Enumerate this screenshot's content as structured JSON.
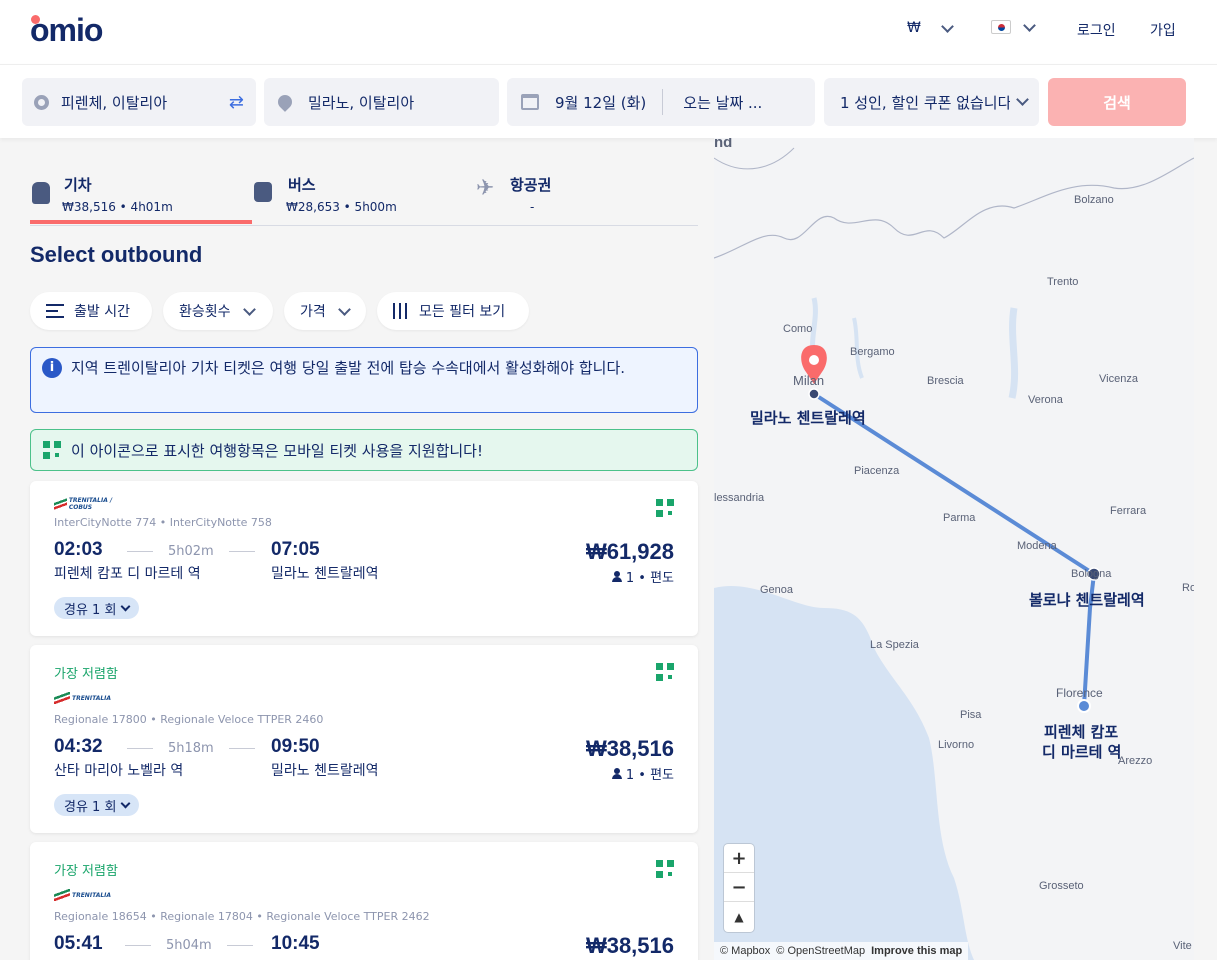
{
  "header": {
    "logo": "omio",
    "currency": "₩",
    "language_flag": "korea-flag",
    "login": "로그인",
    "signup": "가입"
  },
  "search": {
    "from": "피렌체, 이탈리아",
    "to": "밀라노, 이탈리아",
    "depart_date": "9월 12일 (화)",
    "return_date_placeholder": "오는 날짜 ...",
    "passengers": "1 성인, 할인 쿠폰 없습니다",
    "search_button": "검색"
  },
  "tabs": [
    {
      "label": "기차",
      "sub": "₩38,516 • 4h01m",
      "icon": "train-icon",
      "active": true
    },
    {
      "label": "버스",
      "sub": "₩28,653 • 5h00m",
      "icon": "bus-icon",
      "active": false
    },
    {
      "label": "항공권",
      "sub": "-",
      "icon": "plane-icon",
      "active": false
    }
  ],
  "section_title": "Select outbound",
  "filters": {
    "departure_time": "출발 시간",
    "transfers": "환승횟수",
    "price": "가격",
    "all_filters": "모든 필터 보기"
  },
  "info_notice": "지역 트렌이탈리아 기차 티켓은 여행 당일 출발 전에 탑승 수속대에서 활성화해야 합니다.",
  "mobile_notice": "이 아이콘으로 표시한 여행항목은 모바일 티켓 사용을 지원합니다!",
  "results": [
    {
      "badge": "",
      "operator": "TRENITALIA / COBUS",
      "trains": "InterCityNotte 774 • InterCityNotte 758",
      "dep_time": "02:03",
      "duration": "5h02m",
      "arr_time": "07:05",
      "dep_station": "피렌체 캄포 디 마르테 역",
      "arr_station": "밀라노 첸트랄레역",
      "price": "₩61,928",
      "pax": "1 • 편도",
      "transfers": "경유 1 회"
    },
    {
      "badge": "가장 저렴함",
      "operator": "TRENITALIA",
      "trains": "Regionale 17800 • Regionale Veloce TTPER 2460",
      "dep_time": "04:32",
      "duration": "5h18m",
      "arr_time": "09:50",
      "dep_station": "산타 마리아 노벨라 역",
      "arr_station": "밀라노 첸트랄레역",
      "price": "₩38,516",
      "pax": "1 • 편도",
      "transfers": "경유 1 회"
    },
    {
      "badge": "가장 저렴함",
      "operator": "TRENITALIA",
      "trains": "Regionale 18654 • Regionale 17804 • Regionale Veloce TTPER 2462",
      "dep_time": "05:41",
      "duration": "5h04m",
      "arr_time": "10:45",
      "price": "₩38,516"
    }
  ],
  "map": {
    "labels": [
      "nd",
      "Bolzano",
      "Trento",
      "Como",
      "Bergamo",
      "Milan",
      "Brescia",
      "Vicenza",
      "Verona",
      "Piacenza",
      "lessandria",
      "Parma",
      "Ferrara",
      "Modena",
      "Bologna",
      "Ro",
      "Genoa",
      "La Spezia",
      "Florence",
      "Pisa",
      "Livorno",
      "Arezzo",
      "Grosseto",
      "Vite"
    ],
    "stations": {
      "milan": "밀라노 첸트랄레역",
      "bologna": "볼로냐 첸트랄레역",
      "florence_line1": "피렌체 캄포",
      "florence_line2": "디 마르테 역"
    },
    "route_color": "#5b8bd6",
    "zoom_in": "+",
    "zoom_out": "−",
    "compass": "▲",
    "attribution_mapbox": "© Mapbox",
    "attribution_osm": "© OpenStreetMap",
    "improve": "Improve this map"
  }
}
